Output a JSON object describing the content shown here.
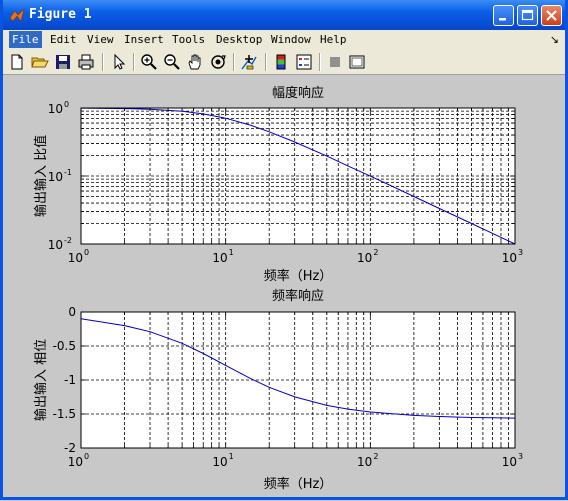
{
  "window": {
    "title": "Figure 1",
    "controls": [
      "minimize",
      "maximize",
      "close"
    ]
  },
  "menu": {
    "items": [
      {
        "label": "File",
        "active": true
      },
      {
        "label": "Edit"
      },
      {
        "label": "View"
      },
      {
        "label": "Insert"
      },
      {
        "label": "Tools"
      },
      {
        "label": "Desktop"
      },
      {
        "label": "Window"
      },
      {
        "label": "Help"
      }
    ],
    "overflow_arrow": "↘"
  },
  "toolbar": {
    "icons": [
      "new-file-icon",
      "open-folder-icon",
      "save-icon",
      "print-icon",
      "pointer-arrow-icon",
      "zoom-in-icon",
      "zoom-out-icon",
      "pan-hand-icon",
      "rotate-3d-icon",
      "data-cursor-icon",
      "colorbar-icon",
      "legend-icon",
      "hide-plot-tools-icon",
      "show-plot-tools-icon"
    ]
  },
  "colors": {
    "line": "#0000cc",
    "titlebar": "#0a5ee8",
    "figure_bg": "#c8c8c8"
  },
  "chart_data": [
    {
      "type": "line",
      "title": "幅度响应",
      "xlabel": "频率（Hz）",
      "ylabel": "输出输入 比值",
      "xscale": "log",
      "yscale": "log",
      "xlim": [
        1,
        1000
      ],
      "ylim": [
        0.01,
        1
      ],
      "grid": true,
      "xticks": [
        {
          "base": "10",
          "exp": "0"
        },
        {
          "base": "10",
          "exp": "1"
        },
        {
          "base": "10",
          "exp": "2"
        },
        {
          "base": "10",
          "exp": "3"
        }
      ],
      "yticks": [
        {
          "base": "10",
          "exp": "-2"
        },
        {
          "base": "10",
          "exp": "-1"
        },
        {
          "base": "10",
          "exp": "0"
        }
      ],
      "series": [
        {
          "x": [
            1,
            2,
            3,
            5,
            7,
            10,
            15,
            20,
            30,
            50,
            70,
            100,
            200,
            300,
            500,
            700,
            1000
          ],
          "y": [
            0.995,
            0.98,
            0.958,
            0.895,
            0.819,
            0.707,
            0.555,
            0.447,
            0.316,
            0.196,
            0.141,
            0.0995,
            0.05,
            0.0333,
            0.02,
            0.0143,
            0.01
          ]
        }
      ]
    },
    {
      "type": "line",
      "title": "频率响应",
      "xlabel": "频率（Hz）",
      "ylabel": "输出输入 相位",
      "xscale": "log",
      "yscale": "linear",
      "xlim": [
        1,
        1000
      ],
      "ylim": [
        -2,
        0
      ],
      "grid": true,
      "xticks": [
        {
          "base": "10",
          "exp": "0"
        },
        {
          "base": "10",
          "exp": "1"
        },
        {
          "base": "10",
          "exp": "2"
        },
        {
          "base": "10",
          "exp": "3"
        }
      ],
      "yticks": [
        {
          "label": "0",
          "value": 0
        },
        {
          "label": "-0.5",
          "value": -0.5
        },
        {
          "label": "-1",
          "value": -1
        },
        {
          "label": "-1.5",
          "value": -1.5
        },
        {
          "label": "-2",
          "value": -2
        }
      ],
      "series": [
        {
          "x": [
            1,
            2,
            3,
            5,
            7,
            10,
            15,
            20,
            30,
            50,
            70,
            100,
            200,
            300,
            500,
            700,
            1000
          ],
          "y": [
            -0.1,
            -0.2,
            -0.29,
            -0.46,
            -0.61,
            -0.785,
            -0.983,
            -1.107,
            -1.249,
            -1.373,
            -1.428,
            -1.471,
            -1.521,
            -1.537,
            -1.551,
            -1.556,
            -1.561
          ]
        }
      ]
    }
  ]
}
